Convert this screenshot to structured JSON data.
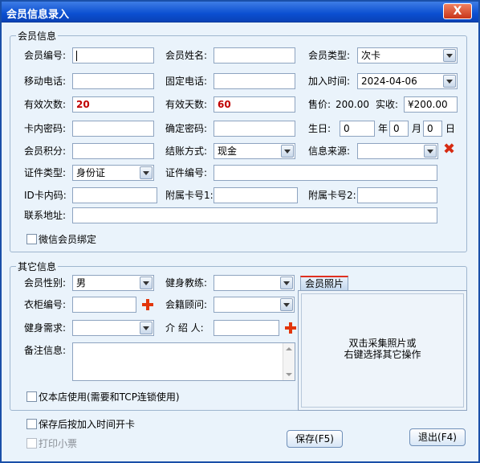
{
  "window": {
    "title": "会员信息录入",
    "close_label": "X"
  },
  "member": {
    "legend": "会员信息",
    "labels": {
      "member_no": "会员编号:",
      "name": "会员姓名:",
      "type": "会员类型:",
      "mobile": "移动电话:",
      "phone": "固定电话:",
      "join_time": "加入时间:",
      "valid_count": "有效次数:",
      "valid_days": "有效天数:",
      "price": "售价:",
      "paid": "实收:",
      "card_pwd": "卡内密码:",
      "confirm_pwd": "确定密码:",
      "birthday": "生日:",
      "year": "年",
      "month": "月",
      "day": "日",
      "points": "会员积分:",
      "settle": "结账方式:",
      "source": "信息来源:",
      "id_type": "证件类型:",
      "id_no": "证件编号:",
      "id_card": "ID卡内码:",
      "sub_card1": "附属卡号1:",
      "sub_card2": "附属卡号2:",
      "address": "联系地址:",
      "wechat": "微信会员绑定"
    },
    "values": {
      "type": "次卡",
      "join_time": "2024-04-06",
      "valid_count": "20",
      "valid_days": "60",
      "price": "200.00",
      "paid": "¥200.00",
      "birth_year": "0",
      "birth_month": "0",
      "birth_day": "0",
      "settle": "现金",
      "id_type": "身份证"
    }
  },
  "other": {
    "legend": "其它信息",
    "labels": {
      "gender": "会员性别:",
      "coach": "健身教练:",
      "locker": "衣柜编号:",
      "advisor": "会籍顾问:",
      "needs": "健身需求:",
      "referrer": "介 绍 人:",
      "remark": "备注信息:",
      "local_only": "仅本店使用(需要和TCP连锁使用)"
    },
    "values": {
      "gender": "男"
    },
    "photo_tab": "会员照片",
    "photo_hint_1": "双击采集照片或",
    "photo_hint_2": "右键选择其它操作"
  },
  "footer": {
    "save_open": "保存后按加入时间开卡",
    "print": "打印小票",
    "save_btn": "保存(F5)",
    "exit_btn": "退出(F4)"
  }
}
